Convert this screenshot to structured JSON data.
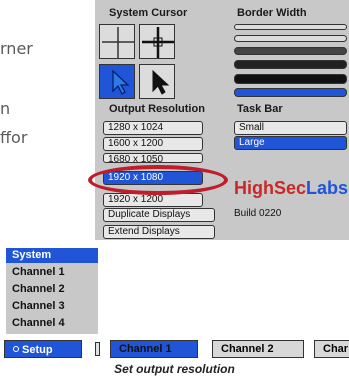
{
  "fragments": [
    "rner",
    "n",
    "ffor"
  ],
  "system_cursor": {
    "title": "System Cursor"
  },
  "border_width": {
    "title": "Border Width"
  },
  "output_resolution": {
    "title": "Output Resolution",
    "options": [
      "1280 x 1024",
      "1600 x 1200",
      "1680 x 1050",
      "1920 x 1080",
      "1920 x 1200"
    ],
    "selected": "1920 x 1080",
    "actions": [
      "Duplicate Displays",
      "Extend Displays"
    ]
  },
  "task_bar": {
    "title": "Task Bar",
    "options": [
      "Small",
      "Large"
    ],
    "selected": "Large"
  },
  "brand": {
    "high": "HighSec",
    "labs": "Labs",
    "build": "Build 0220"
  },
  "channels": {
    "items": [
      "System",
      "Channel 1",
      "Channel 2",
      "Channel 3",
      "Channel 4"
    ],
    "selected": "System"
  },
  "bottom_bar": {
    "setup": "Setup",
    "tabs": [
      "Channel 1",
      "Channel 2",
      "Char"
    ],
    "selected": "Channel 1"
  },
  "caption": "Set output resolution",
  "colors": {
    "accent": "#1f55d6",
    "panel": "#c8c8c8",
    "highlight_ring": "#c01d2a",
    "brand_red": "#c82828"
  }
}
